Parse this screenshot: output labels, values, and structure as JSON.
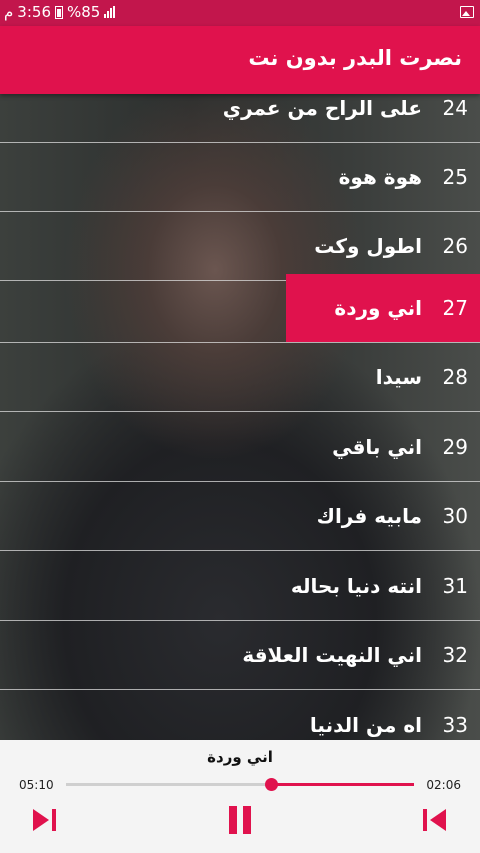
{
  "status": {
    "time": "3:56",
    "battery": "%85",
    "carrier": "م"
  },
  "appbar": {
    "title": "نصرت البدر بدون نت"
  },
  "songs": [
    {
      "num": "24",
      "title": "على الراح من عمري"
    },
    {
      "num": "25",
      "title": "هوة هوة"
    },
    {
      "num": "26",
      "title": "اطول وكت"
    },
    {
      "num": "27",
      "title": "اني وردة"
    },
    {
      "num": "28",
      "title": "سيدا"
    },
    {
      "num": "29",
      "title": "اني باقي"
    },
    {
      "num": "30",
      "title": "مابيه فراك"
    },
    {
      "num": "31",
      "title": "انته دنيا بحاله"
    },
    {
      "num": "32",
      "title": "اني النهيت العلاقة"
    },
    {
      "num": "33",
      "title": "اه من الدنيا"
    }
  ],
  "player": {
    "now_playing": "اني وردة",
    "time_left": "05:10",
    "time_right": "02:06",
    "progress": 0.41,
    "accent": "#e0124d"
  }
}
